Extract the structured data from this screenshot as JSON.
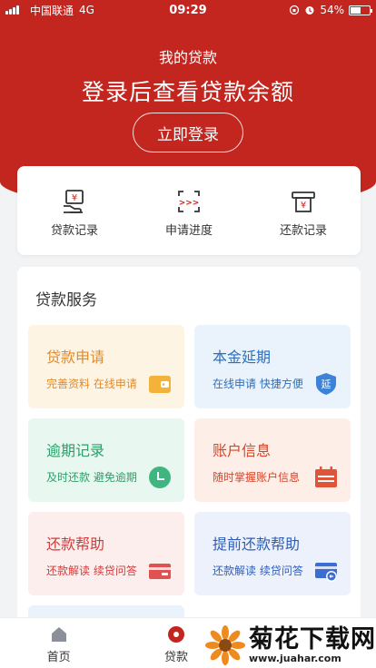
{
  "status": {
    "carrier": "中国联通",
    "network": "4G",
    "time": "09:29",
    "battery": "54%"
  },
  "header": {
    "title": "我的贷款",
    "subtitle": "登录后查看贷款余额",
    "login_label": "立即登录"
  },
  "quick": [
    {
      "label": "贷款记录",
      "icon": "loan-record-icon"
    },
    {
      "label": "申请进度",
      "icon": "progress-icon"
    },
    {
      "label": "还款记录",
      "icon": "repay-record-icon"
    }
  ],
  "services": {
    "title": "贷款服务",
    "items": [
      {
        "title": "贷款申请",
        "desc": "完善资料 在线申请",
        "bg": "#fdf4e3",
        "color": "#e18b2c",
        "icon": "wallet-icon"
      },
      {
        "title": "本金延期",
        "desc": "在线申请 快捷方便",
        "bg": "#eaf3fc",
        "color": "#2f6fb8",
        "icon": "extend-shield-icon"
      },
      {
        "title": "逾期记录",
        "desc": "及时还款 避免逾期",
        "bg": "#e8f7ef",
        "color": "#2f9e6a",
        "icon": "clock-icon"
      },
      {
        "title": "账户信息",
        "desc": "随时掌握账户信息",
        "bg": "#fdeee8",
        "color": "#d6452a",
        "icon": "calendar-icon"
      },
      {
        "title": "还款帮助",
        "desc": "还款解读 续贷问答",
        "bg": "#fdeeee",
        "color": "#d23b3b",
        "icon": "card-icon"
      },
      {
        "title": "提前还款帮助",
        "desc": "还款解读 续贷问答",
        "bg": "#ecf1fc",
        "color": "#2f5eb8",
        "icon": "card-return-icon"
      }
    ]
  },
  "nav": {
    "home": "首页",
    "loan": "贷款"
  },
  "watermark": {
    "name": "菊花下载网",
    "url": "www.juahar.com"
  },
  "colors": {
    "brand": "#c3261f"
  }
}
